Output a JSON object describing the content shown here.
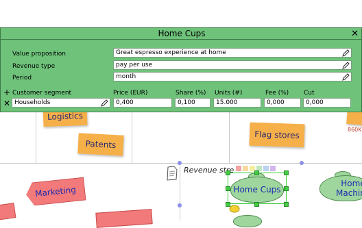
{
  "canvas": {
    "stickies": [
      {
        "label": "Logistics"
      },
      {
        "label": "Patents"
      },
      {
        "label": "Flag stores"
      }
    ],
    "tags": [
      {
        "label": "Marketing"
      }
    ],
    "bags": [
      {
        "label": "Home Cups"
      },
      {
        "label": "Home Machines"
      }
    ],
    "revenue_streams_label": "Revenue stre",
    "side_value": "860K",
    "swatch_colors": [
      "#f5a3a3",
      "#f7d9a0",
      "#f2ef9c",
      "#bfe6bf",
      "#b9d2f2",
      "#d4b6ee"
    ]
  },
  "panel": {
    "title": "Home Cups",
    "close_symbol": "✕",
    "value_proposition_label": "Value proposition",
    "value_proposition_value": "Great espresso experience at home",
    "revenue_type_label": "Revenue type",
    "revenue_type_value": "pay per use",
    "period_label": "Period",
    "period_value": "month",
    "segment_add_symbol": "+",
    "segment_remove_symbol": "✕",
    "customer_segment_label": "Customer segment",
    "customer_segment_value": "Households",
    "price_label": "Price (EUR)",
    "price_value": "0,400",
    "share_label": "Share (%)",
    "share_value": "0,100",
    "units_label": "Units (#)",
    "units_value": "15.000",
    "fee_label": "Fee (%)",
    "fee_value": "0,000",
    "cut_label": "Cut",
    "cut_value": "0,000"
  },
  "colors": {
    "panel_green": "#6ec27a",
    "sticky_orange": "#f6b04a",
    "tag_red": "#f27a7a",
    "bag_green": "#9ed69e",
    "selection_green": "#33cc33",
    "text_blue": "#1f2bb0"
  }
}
